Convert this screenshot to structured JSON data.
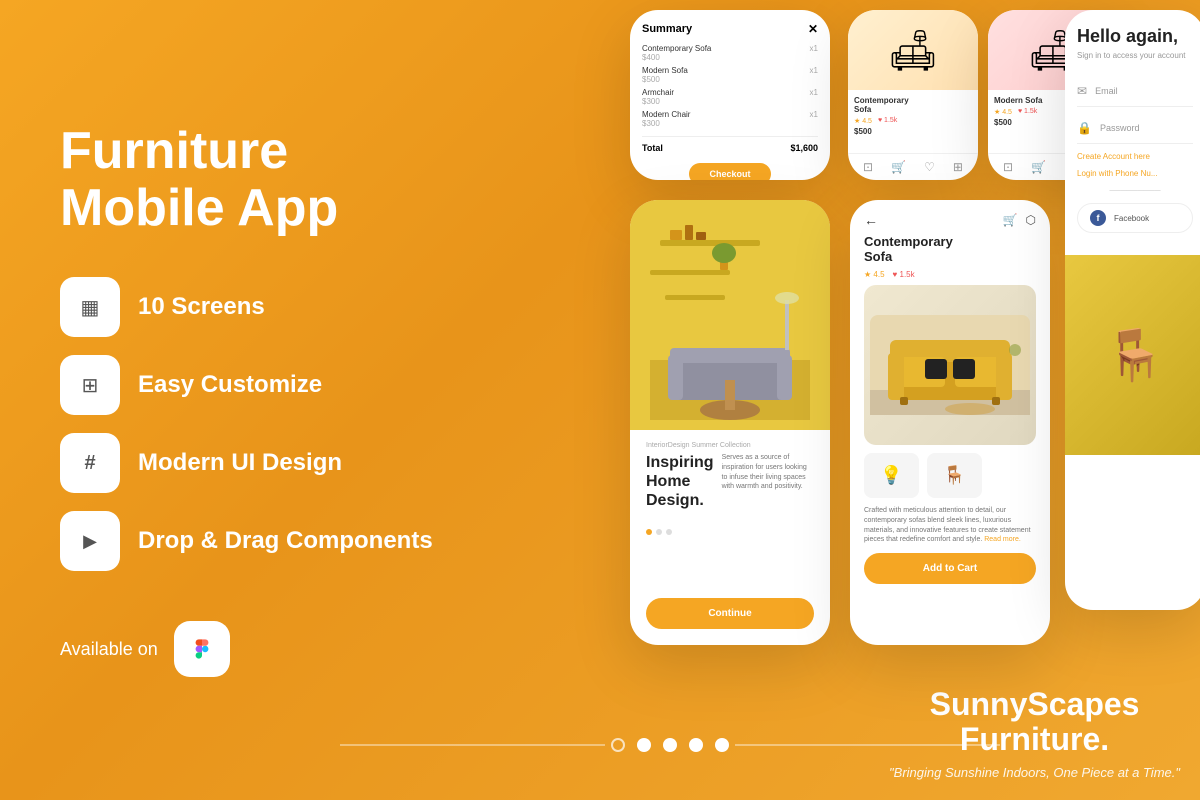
{
  "page": {
    "background": "#F5A623"
  },
  "left": {
    "title": "Furniture Mobile App",
    "features": [
      {
        "id": "screens",
        "icon": "▦",
        "label": "10 Screens"
      },
      {
        "id": "customize",
        "icon": "⊞",
        "label": "Easy Customize"
      },
      {
        "id": "modern",
        "icon": "#",
        "label": "Modern UI Design"
      },
      {
        "id": "dragdrop",
        "icon": "▶",
        "label": "Drop & Drag Components"
      }
    ],
    "available_text": "Available on",
    "figma_icon": "🎨"
  },
  "pagination": {
    "dots": [
      "empty",
      "filled",
      "filled",
      "filled",
      "filled"
    ]
  },
  "brand": {
    "name": "SunnyScapes\nFurniture.",
    "tagline": "\"Bringing Sunshine Indoors, One Piece at a Time.\""
  },
  "checkout_screen": {
    "title": "Summary",
    "items": [
      {
        "name": "Contemporary Sofa",
        "price": "$400",
        "qty": "x1"
      },
      {
        "name": "Modern Sofa",
        "price": "$500",
        "qty": "x1"
      },
      {
        "name": "Armchair",
        "price": "$300",
        "qty": "x1"
      },
      {
        "name": "Modern Chair",
        "price": "$300",
        "qty": "x1"
      }
    ],
    "total_label": "Total",
    "total_value": "$1,600",
    "button": "Checkout"
  },
  "product_card_1": {
    "name": "Contemporary\nSofa",
    "rating": "★ 4.5",
    "likes": "♥ 1.5k",
    "price": "$500"
  },
  "product_card_2": {
    "name": "Modern Sofa",
    "rating": "★ 4.5",
    "likes": "♥ 1.5k",
    "price": "$500"
  },
  "onboarding_screen": {
    "small_text": "InteriorDesign Summer Collection",
    "heading": "Inspiring\nHome Design.",
    "description": "Serves as a source of inspiration for users looking to infuse their living spaces with warmth and positivity.",
    "button": "Continue"
  },
  "detail_screen": {
    "product_name": "Contemporary\nSofa",
    "rating": "★ 4.5",
    "likes": "♥ 1.5k",
    "description": "Crafted with meticulous attention to detail, our contemporary sofas blend sleek lines, luxurious materials, and innovative features to create statement pieces that redefine comfort and style.",
    "read_more": "Read more.",
    "button": "Add to Cart"
  },
  "login_screen": {
    "hello": "Hello again,",
    "sub": "Sign in to access your account",
    "email_placeholder": "Email",
    "password_placeholder": "Password",
    "create_account": "Create Account here",
    "login_phone": "Login with Phone Nu...",
    "facebook": "Facebook"
  }
}
